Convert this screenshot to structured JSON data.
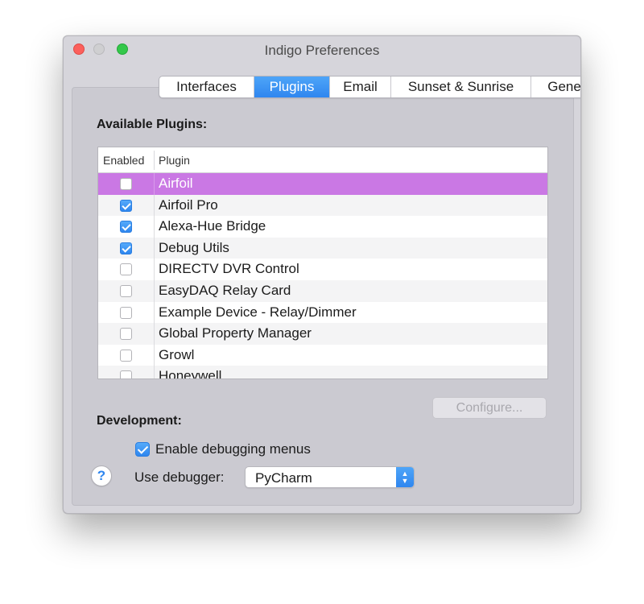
{
  "window": {
    "title": "Indigo Preferences"
  },
  "tabs": [
    {
      "label": "Interfaces",
      "selected": false
    },
    {
      "label": "Plugins",
      "selected": true
    },
    {
      "label": "Email",
      "selected": false
    },
    {
      "label": "Sunset & Sunrise",
      "selected": false
    },
    {
      "label": "General",
      "selected": false
    }
  ],
  "plugins": {
    "section_label": "Available Plugins:",
    "columns": {
      "enabled": "Enabled",
      "plugin": "Plugin"
    },
    "rows": [
      {
        "name": "Airfoil",
        "enabled": false,
        "selected": true
      },
      {
        "name": "Airfoil Pro",
        "enabled": true,
        "selected": false
      },
      {
        "name": "Alexa-Hue Bridge",
        "enabled": true,
        "selected": false
      },
      {
        "name": "Debug Utils",
        "enabled": true,
        "selected": false
      },
      {
        "name": "DIRECTV DVR Control",
        "enabled": false,
        "selected": false
      },
      {
        "name": "EasyDAQ Relay Card",
        "enabled": false,
        "selected": false
      },
      {
        "name": "Example Device - Relay/Dimmer",
        "enabled": false,
        "selected": false
      },
      {
        "name": "Global Property Manager",
        "enabled": false,
        "selected": false
      },
      {
        "name": "Growl",
        "enabled": false,
        "selected": false
      },
      {
        "name": "Honeywell",
        "enabled": false,
        "selected": false
      }
    ],
    "configure_button": "Configure..."
  },
  "development": {
    "section_label": "Development:",
    "debug_menus_label": "Enable debugging menus",
    "debug_menus_checked": true,
    "debugger_label": "Use debugger:",
    "debugger_value": "PyCharm",
    "help_symbol": "?"
  },
  "colors": {
    "accent": "#2f86ef",
    "selected_row": "#ca78e4"
  }
}
